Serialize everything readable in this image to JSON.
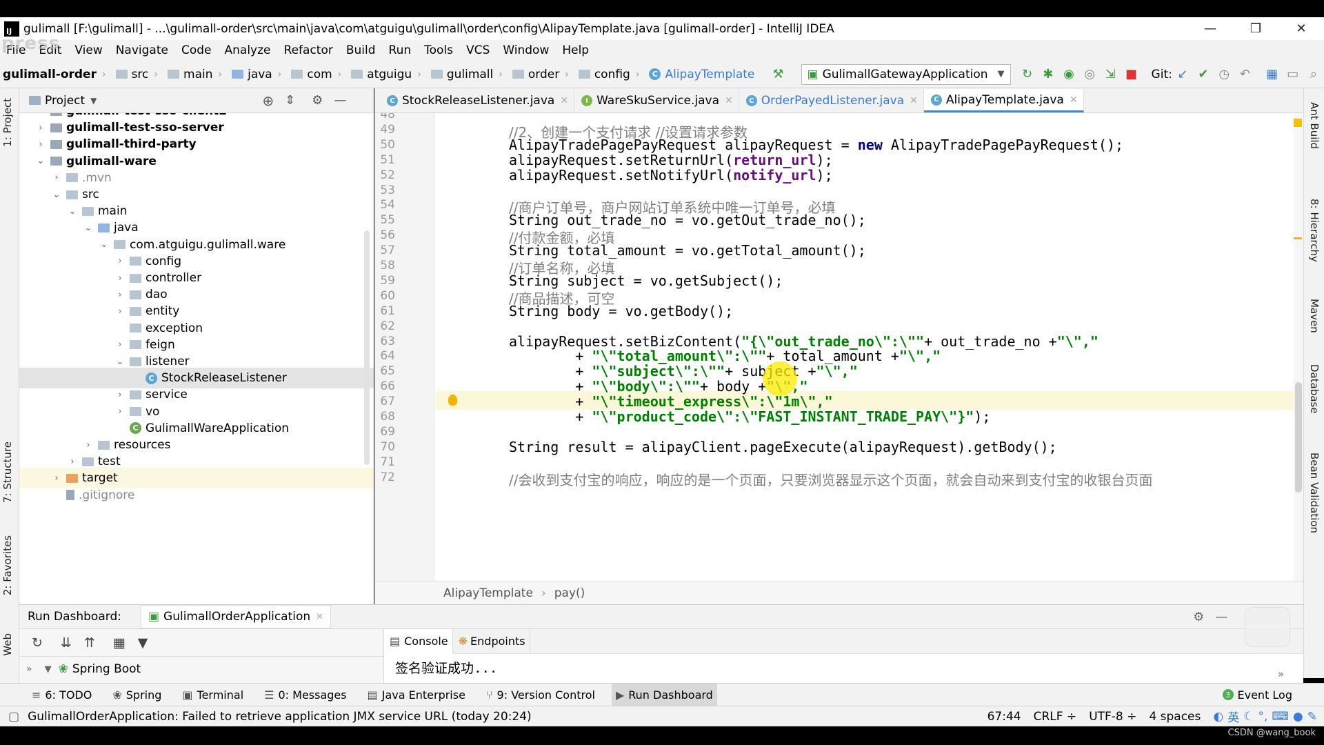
{
  "window": {
    "app_icon": "IJ",
    "title": "gulimall [F:\\gulimall] - ...\\gulimall-order\\src\\main\\java\\com\\atguigu\\gulimall\\order\\config\\AlipayTemplate.java [gulimall-order] - IntelliJ IDEA",
    "minimize": "—",
    "restore": "❐",
    "close": "✕",
    "watermark": "press"
  },
  "menu": [
    "File",
    "Edit",
    "View",
    "Navigate",
    "Code",
    "Analyze",
    "Refactor",
    "Build",
    "Run",
    "Tools",
    "VCS",
    "Window",
    "Help"
  ],
  "navbar": {
    "crumbs": [
      "gulimall-order",
      "src",
      "main",
      "java",
      "com",
      "atguigu",
      "gulimall",
      "order",
      "config",
      "AlipayTemplate"
    ],
    "run_config": "GulimallGatewayApplication",
    "git_label": "Git:"
  },
  "project": {
    "header": "Project",
    "tree": [
      {
        "label": "gulimall-test-sso-client2",
        "depth": 1,
        "arrow": "right",
        "icon": "module",
        "bold": true
      },
      {
        "label": "gulimall-test-sso-server",
        "depth": 1,
        "arrow": "right",
        "icon": "module",
        "bold": true
      },
      {
        "label": "gulimall-third-party",
        "depth": 1,
        "arrow": "right",
        "icon": "module",
        "bold": true
      },
      {
        "label": "gulimall-ware",
        "depth": 1,
        "arrow": "down",
        "icon": "module",
        "bold": true
      },
      {
        "label": ".mvn",
        "depth": 2,
        "arrow": "right",
        "icon": "folder",
        "muted": true
      },
      {
        "label": "src",
        "depth": 2,
        "arrow": "down",
        "icon": "folder"
      },
      {
        "label": "main",
        "depth": 3,
        "arrow": "down",
        "icon": "folder"
      },
      {
        "label": "java",
        "depth": 4,
        "arrow": "down",
        "icon": "folder-blue"
      },
      {
        "label": "com.atguigu.gulimall.ware",
        "depth": 5,
        "arrow": "down",
        "icon": "package"
      },
      {
        "label": "config",
        "depth": 6,
        "arrow": "right",
        "icon": "package"
      },
      {
        "label": "controller",
        "depth": 6,
        "arrow": "right",
        "icon": "package"
      },
      {
        "label": "dao",
        "depth": 6,
        "arrow": "right",
        "icon": "package"
      },
      {
        "label": "entity",
        "depth": 6,
        "arrow": "right",
        "icon": "package"
      },
      {
        "label": "exception",
        "depth": 6,
        "arrow": "none",
        "icon": "package"
      },
      {
        "label": "feign",
        "depth": 6,
        "arrow": "right",
        "icon": "package"
      },
      {
        "label": "listener",
        "depth": 6,
        "arrow": "down",
        "icon": "package"
      },
      {
        "label": "StockReleaseListener",
        "depth": 7,
        "arrow": "none",
        "icon": "class",
        "selected": true
      },
      {
        "label": "service",
        "depth": 6,
        "arrow": "right",
        "icon": "package"
      },
      {
        "label": "vo",
        "depth": 6,
        "arrow": "right",
        "icon": "package"
      },
      {
        "label": "GulimallWareApplication",
        "depth": 6,
        "arrow": "none",
        "icon": "spring-class"
      },
      {
        "label": "resources",
        "depth": 4,
        "arrow": "right",
        "icon": "folder"
      },
      {
        "label": "test",
        "depth": 3,
        "arrow": "right",
        "icon": "folder"
      },
      {
        "label": "target",
        "depth": 2,
        "arrow": "right",
        "icon": "folder-orange",
        "highlight": true
      },
      {
        "label": ".gitignore",
        "depth": 2,
        "arrow": "none",
        "icon": "file",
        "muted": true
      }
    ]
  },
  "tabs": [
    {
      "label": "StockReleaseListener.java",
      "icon": "class",
      "color": "#5aa5d8"
    },
    {
      "label": "WareSkuService.java",
      "icon": "interface",
      "color": "#7bb84a"
    },
    {
      "label": "OrderPayedListener.java",
      "icon": "class",
      "color": "#5aa5d8",
      "modified": true
    },
    {
      "label": "AlipayTemplate.java",
      "icon": "class",
      "color": "#5aa5d8",
      "active": true
    }
  ],
  "editor": {
    "current_line": 67,
    "lines": [
      {
        "n": "48",
        "html": ""
      },
      {
        "n": "49",
        "html": "<span class=\"cmt\">//2、创建一个支付请求 //设置请求参数</span>"
      },
      {
        "n": "50",
        "html": "AlipayTradePagePayRequest alipayRequest = <span class=\"kw\">new</span> AlipayTradePagePayRequest();"
      },
      {
        "n": "51",
        "html": "alipayRequest.setReturnUrl(<span class=\"fld\">return_url</span>);"
      },
      {
        "n": "52",
        "html": "alipayRequest.setNotifyUrl(<span class=\"fld\">notify_url</span>);"
      },
      {
        "n": "53",
        "html": ""
      },
      {
        "n": "54",
        "html": "<span class=\"cmt\">//商户订单号，商户网站订单系统中唯一订单号，必填</span>"
      },
      {
        "n": "55",
        "html": "String out_trade_no = vo.getOut_trade_no();"
      },
      {
        "n": "56",
        "html": "<span class=\"cmt\">//付款金额，必填</span>"
      },
      {
        "n": "57",
        "html": "String total_amount = vo.getTotal_amount();"
      },
      {
        "n": "58",
        "html": "<span class=\"cmt\">//订单名称，必填</span>"
      },
      {
        "n": "59",
        "html": "String subject = vo.getSubject();"
      },
      {
        "n": "60",
        "html": "<span class=\"cmt\">//商品描述，可空</span>"
      },
      {
        "n": "61",
        "html": "String body = vo.getBody();"
      },
      {
        "n": "62",
        "html": ""
      },
      {
        "n": "63",
        "html": "alipayRequest.setBizContent(<span class=\"str\">\"{\\\"out_trade_no\\\":\\\"\"</span>+ out_trade_no +<span class=\"str\">\"\\\",\"</span>"
      },
      {
        "n": "64",
        "html": "        + <span class=\"str\">\"\\\"total_amount\\\":\\\"\"</span>+ total_amount +<span class=\"str\">\"\\\",\"</span>"
      },
      {
        "n": "65",
        "html": "        + <span class=\"str\">\"\\\"subject\\\":\\\"\"</span>+ subject +<span class=\"str\">\"\\\",\"</span>"
      },
      {
        "n": "66",
        "html": "        + <span class=\"str\">\"\\\"body\\\":\\\"\"</span>+ body +<span class=\"str\">\"\\\",\"</span>"
      },
      {
        "n": "67",
        "html": "        + <span class=\"str\">\"\\\"timeout_express\\\":\\\"1m\\\",\"</span>"
      },
      {
        "n": "68",
        "html": "        + <span class=\"str\">\"\\\"product_code\\\":\\\"FAST_INSTANT_TRADE_PAY\\\"}\"</span>);"
      },
      {
        "n": "69",
        "html": ""
      },
      {
        "n": "70",
        "html": "String result = alipayClient.pageExecute(alipayRequest).getBody();"
      },
      {
        "n": "71",
        "html": ""
      },
      {
        "n": "72",
        "html": "<span class=\"cmt\">//会收到支付宝的响应，响应的是一个页面，只要浏览器显示这个页面，就会自动来到支付宝的收银台页面</span>"
      }
    ],
    "breadcrumb": [
      "AlipayTemplate",
      "pay()"
    ]
  },
  "run": {
    "title": "Run Dashboard:",
    "app_tab": "GulimallOrderApplication",
    "tree_item": "Spring Boot",
    "console_tab": "Console",
    "endpoints_tab": "Endpoints",
    "console_output": "签名验证成功..."
  },
  "left_tools": [
    "1: Project",
    "7: Structure",
    "2: Favorites",
    "Web"
  ],
  "right_tools": [
    "Ant Build",
    "8: Hierarchy",
    "Maven",
    "Database",
    "Bean Validation"
  ],
  "bottom_tabs": [
    {
      "label": "6: TODO",
      "icon": "≡"
    },
    {
      "label": "Spring",
      "icon": "❀"
    },
    {
      "label": "Terminal",
      "icon": "▣"
    },
    {
      "label": "0: Messages",
      "icon": "☰"
    },
    {
      "label": "Java Enterprise",
      "icon": "▤"
    },
    {
      "label": "9: Version Control",
      "icon": "⑂"
    },
    {
      "label": "Run Dashboard",
      "icon": "▶",
      "active": true
    }
  ],
  "event_log": {
    "label": "Event Log",
    "count": "3"
  },
  "status": {
    "message": "GulimallOrderApplication: Failed to retrieve application JMX service URL (today 20:24)",
    "position": "67:44",
    "line_sep": "CRLF ÷",
    "encoding": "UTF-8 ÷",
    "indent": "4 spaces",
    "ime": "英"
  },
  "credit": "CSDN @wang_book"
}
